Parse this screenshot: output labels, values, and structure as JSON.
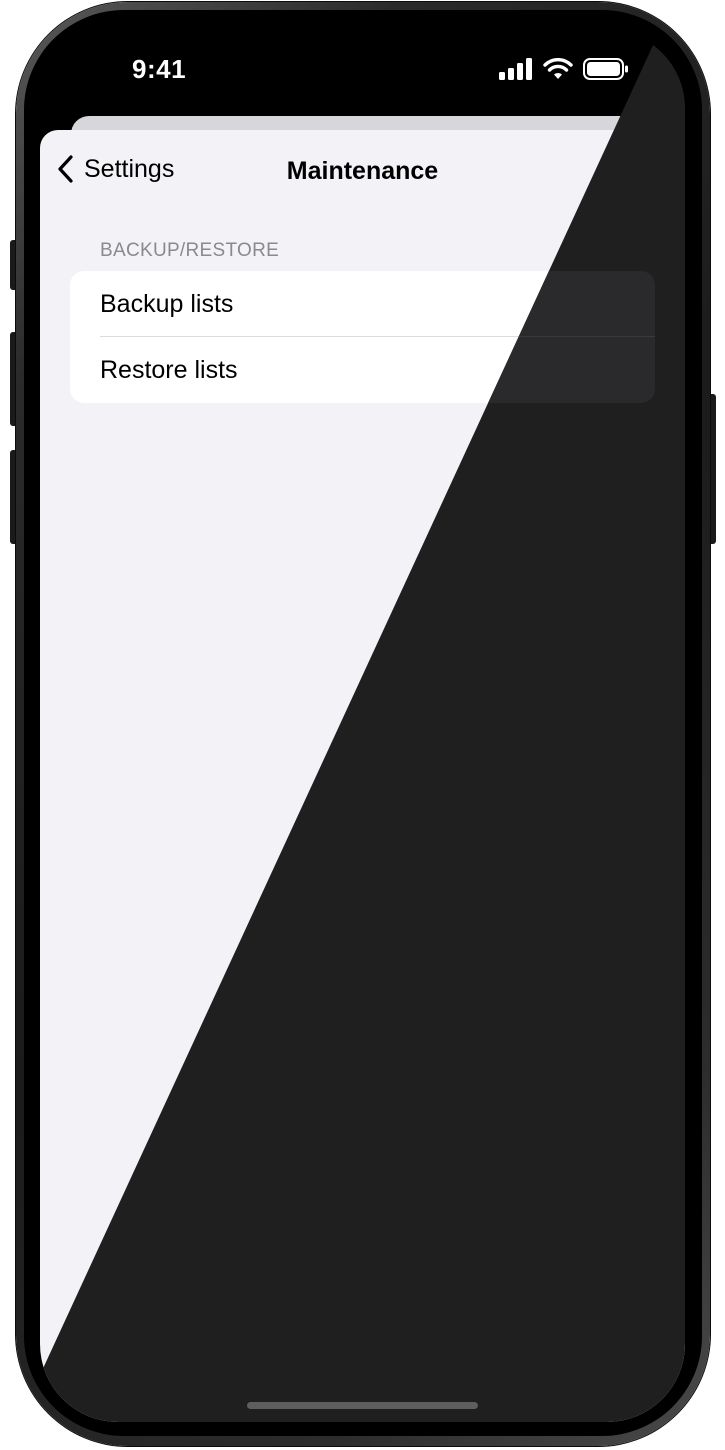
{
  "status_bar": {
    "time": "9:41",
    "icons": [
      "signal-icon",
      "wifi-icon",
      "battery-icon"
    ]
  },
  "nav": {
    "back_label": "Settings",
    "back_icon": "chevron-left-icon",
    "title": "Maintenance"
  },
  "section": {
    "header": "BACKUP/RESTORE",
    "items": [
      {
        "label": "Backup lists",
        "icon": "chevron-right-icon"
      },
      {
        "label": "Restore lists",
        "icon": "chevron-right-icon"
      }
    ]
  },
  "colors": {
    "light_background": "#f2f2f7",
    "dark_background": "#1f1f20",
    "cell_background": "#ffffff",
    "secondary_text": "#8a8a8e",
    "frame": "#1b1b1b"
  }
}
